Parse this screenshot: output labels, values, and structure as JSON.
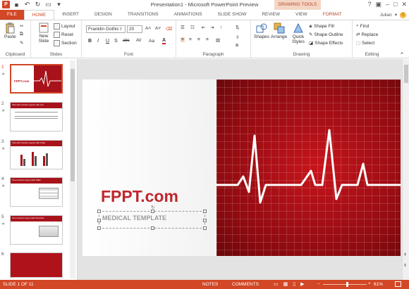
{
  "window": {
    "title": "Presentation1 - Microsoft PowerPoint Preview",
    "contextual_tab_group": "DRAWING TOOLS",
    "user": "Julian"
  },
  "tabs": [
    "FILE",
    "HOME",
    "INSERT",
    "DESIGN",
    "TRANSITIONS",
    "ANIMATIONS",
    "SLIDE SHOW",
    "REVIEW",
    "VIEW",
    "FORMAT"
  ],
  "active_tab": "HOME",
  "ribbon": {
    "clipboard": {
      "label": "Clipboard",
      "paste": "Paste"
    },
    "slides": {
      "label": "Slides",
      "new_slide": "New Slide",
      "layout": "Layout",
      "reset": "Reset",
      "section": "Section"
    },
    "font": {
      "label": "Font",
      "family": "Franklin Gothic I",
      "size": "20",
      "bold": "B",
      "italic": "I",
      "underline": "U",
      "strike": "S",
      "shadow": "abc",
      "spacing": "AV",
      "case": "Aa",
      "color": "A"
    },
    "paragraph": {
      "label": "Paragraph"
    },
    "drawing": {
      "label": "Drawing",
      "shapes": "Shapes",
      "arrange": "Arrange",
      "quick_styles": "Quick Styles",
      "shape_fill": "Shape Fill",
      "shape_outline": "Shape Outline",
      "shape_effects": "Shape Effects"
    },
    "editing": {
      "label": "Editing",
      "find": "Find",
      "replace": "Replace",
      "select": "Select"
    }
  },
  "thumbnails": [
    {
      "num": "1",
      "selected": true,
      "title": "FPPT.com"
    },
    {
      "num": "2",
      "title": "Title with Content Layout with List"
    },
    {
      "num": "3",
      "title": "Title with Content Layout with Chart"
    },
    {
      "num": "4",
      "title": "Two Content Layout with Table"
    },
    {
      "num": "5",
      "title": "Two Content Layout with SmartArt"
    },
    {
      "num": "6",
      "title": ""
    }
  ],
  "slide": {
    "title": "FPPT.com",
    "subtitle": "MEDICAL TEMPLATE"
  },
  "status": {
    "slide_counter": "SLIDE 1 OF 11",
    "notes": "NOTES",
    "comments": "COMMENTS",
    "zoom": "61%"
  },
  "colors": {
    "accent": "#d24726",
    "brand_text": "#c0272d",
    "slide_red": "#b0121a"
  }
}
